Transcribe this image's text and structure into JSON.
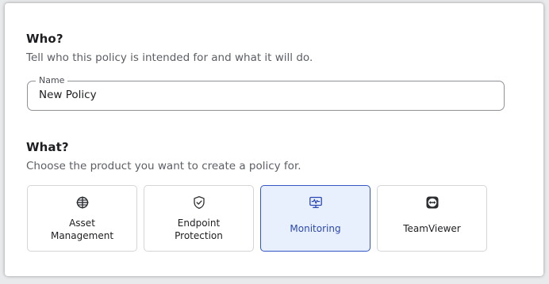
{
  "who": {
    "title": "Who?",
    "subtitle": "Tell who this policy is intended for and what it will do.",
    "name_field": {
      "label": "Name",
      "value": "New Policy"
    }
  },
  "what": {
    "title": "What?",
    "subtitle": "Choose the product you want to create a policy for.",
    "products": [
      {
        "label_line1": "Asset",
        "label_line2": "Management",
        "icon": "crosshair-grid-icon",
        "selected": false
      },
      {
        "label_line1": "Endpoint",
        "label_line2": "Protection",
        "icon": "shield-check-icon",
        "selected": false
      },
      {
        "label": "Monitoring",
        "icon": "monitor-pulse-icon",
        "selected": true
      },
      {
        "label": "TeamViewer",
        "icon": "teamviewer-icon",
        "selected": false
      }
    ]
  },
  "colors": {
    "selected_border": "#3456c4",
    "selected_bg": "#e8effd",
    "selected_text": "#2c48b2"
  }
}
